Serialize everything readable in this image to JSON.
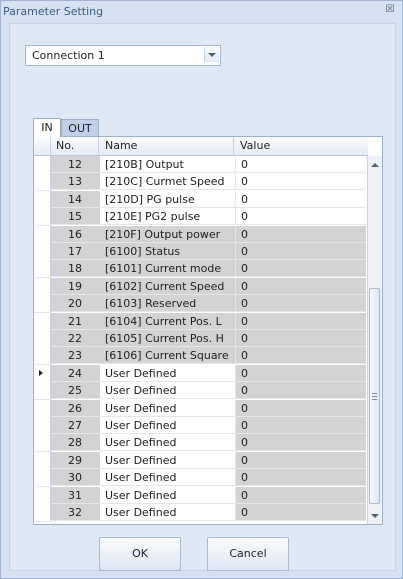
{
  "window": {
    "title": "Parameter Setting",
    "close_glyph": "☒"
  },
  "connection": {
    "selected": "Connection 1"
  },
  "tabs": [
    {
      "label": "IN",
      "active": true
    },
    {
      "label": "OUT",
      "active": false
    }
  ],
  "grid": {
    "headers": {
      "no": "No.",
      "name": "Name",
      "value": "Value"
    },
    "current_row": "24",
    "rows": [
      {
        "no": "12",
        "name": "[210B] Output",
        "value": "0",
        "editable": true
      },
      {
        "no": "13",
        "name": "[210C] Curmet Speed",
        "value": "0",
        "editable": true
      },
      {
        "no": "14",
        "name": "[210D] PG pulse",
        "value": "0",
        "editable": true
      },
      {
        "no": "15",
        "name": "[210E] PG2 pulse",
        "value": "0",
        "editable": true
      },
      {
        "no": "16",
        "name": "[210F] Output power",
        "value": "0",
        "editable": false
      },
      {
        "no": "17",
        "name": "[6100] Status",
        "value": "0",
        "editable": false
      },
      {
        "no": "18",
        "name": "[6101] Current mode",
        "value": "0",
        "editable": false
      },
      {
        "no": "19",
        "name": "[6102] Current Speed",
        "value": "0",
        "editable": false
      },
      {
        "no": "20",
        "name": "[6103] Reserved",
        "value": "0",
        "editable": false
      },
      {
        "no": "21",
        "name": "[6104] Current Pos. L",
        "value": "0",
        "editable": false
      },
      {
        "no": "22",
        "name": "[6105] Current Pos. H",
        "value": "0",
        "editable": false
      },
      {
        "no": "23",
        "name": "[6106] Current Square",
        "value": "0",
        "editable": false
      },
      {
        "no": "24",
        "name": "User Defined",
        "value": "0",
        "editable": false
      },
      {
        "no": "25",
        "name": "User Defined",
        "value": "0",
        "editable": false
      },
      {
        "no": "26",
        "name": "User Defined",
        "value": "0",
        "editable": false
      },
      {
        "no": "27",
        "name": "User Defined",
        "value": "0",
        "editable": false
      },
      {
        "no": "28",
        "name": "User Defined",
        "value": "0",
        "editable": false
      },
      {
        "no": "29",
        "name": "User Defined",
        "value": "0",
        "editable": false
      },
      {
        "no": "30",
        "name": "User Defined",
        "value": "0",
        "editable": false
      },
      {
        "no": "31",
        "name": "User Defined",
        "value": "0",
        "editable": false
      },
      {
        "no": "32",
        "name": "User Defined",
        "value": "0",
        "editable": false
      }
    ]
  },
  "buttons": {
    "ok": "OK",
    "cancel": "Cancel"
  }
}
